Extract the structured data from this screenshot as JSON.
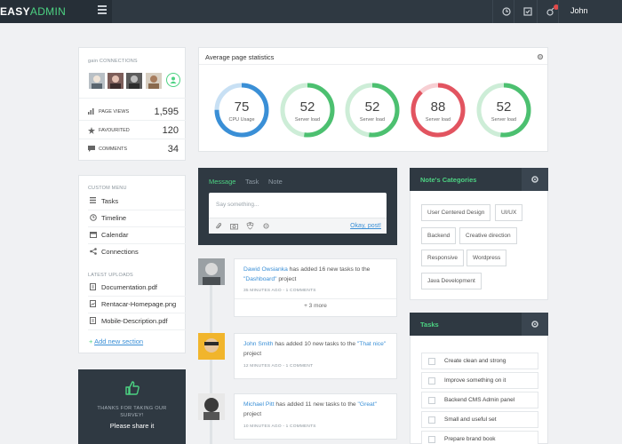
{
  "app": {
    "brand_part1": "EASY",
    "brand_part2": "ADMIN",
    "user_name": "John",
    "accent": "#4cd282"
  },
  "topbar_icons": [
    "menu-icon",
    "clock-icon",
    "checkbox-icon",
    "notification-icon"
  ],
  "connections": {
    "caption": "gain CONNECTIONS",
    "stats": [
      {
        "label": "PAGE VIEWS",
        "value": "1,595",
        "icon": "bar-chart-icon"
      },
      {
        "label": "FAVOURITED",
        "value": "120",
        "icon": "star-icon"
      },
      {
        "label": "COMMENTS",
        "value": "34",
        "icon": "comment-icon"
      }
    ]
  },
  "stats_card": {
    "title": "Average page statistics",
    "gauges": [
      {
        "value": "75",
        "label": "CPU Usage",
        "percent": 0.75,
        "color": "#3a8fd6"
      },
      {
        "value": "52",
        "label": "Server load",
        "percent": 0.52,
        "color": "#4cc070"
      },
      {
        "value": "52",
        "label": "Server load",
        "percent": 0.52,
        "color": "#4cc070"
      },
      {
        "value": "88",
        "label": "Server load",
        "percent": 0.88,
        "color": "#e25460"
      },
      {
        "value": "52",
        "label": "Server load",
        "percent": 0.52,
        "color": "#4cc070"
      }
    ]
  },
  "custom_menu": {
    "caption": "CUSTOM MENU",
    "items": [
      "Tasks",
      "Timeline",
      "Calendar",
      "Connections"
    ],
    "uploads_caption": "LATEST UPLOADS",
    "uploads": [
      "Documentation.pdf",
      "Rentacar-Homepage.png",
      "Mobile-Description.pdf"
    ],
    "add_section": "Add new section"
  },
  "survey": {
    "line1": "THANKS FOR TAKING OUR",
    "line2": "SURVEY!",
    "action": "Please share it"
  },
  "message_box": {
    "tabs": [
      "Message",
      "Task",
      "Note"
    ],
    "placeholder": "Say something...",
    "post": "Okay, post!"
  },
  "timeline": [
    {
      "name": "Dawid Owsianka",
      "text": " has added 16 new tasks to the ",
      "project": "\"Dashboard\"",
      "suffix": " project",
      "meta": "35 MINUTES AGO - 1 COMMENTS",
      "more": "+ 3 more"
    },
    {
      "name": "John Smith",
      "text": " has added 10 new tasks to the ",
      "project": "\"That nice\"",
      "suffix": " project",
      "meta": "12 MINUTES AGO - 1 COMMENT"
    },
    {
      "name": "Michael Pitt",
      "text": " has added 11 new tasks to the ",
      "project": "\"Great\"",
      "suffix": " project",
      "meta": "10 MINUTES AGO - 1 COMMENTS"
    }
  ],
  "notes_categories": {
    "title": "Note's Categories",
    "tags": [
      "User Centered Design",
      "UI/UX",
      "Backend",
      "Creative direction",
      "Responsive",
      "Wordpress",
      "Java Development"
    ]
  },
  "tasks_panel": {
    "title": "Tasks",
    "items": [
      "Create clean and strong",
      "Improve something on it",
      "Backend CMS Admin panel",
      "Small and useful set",
      "Prepare brand book"
    ]
  }
}
